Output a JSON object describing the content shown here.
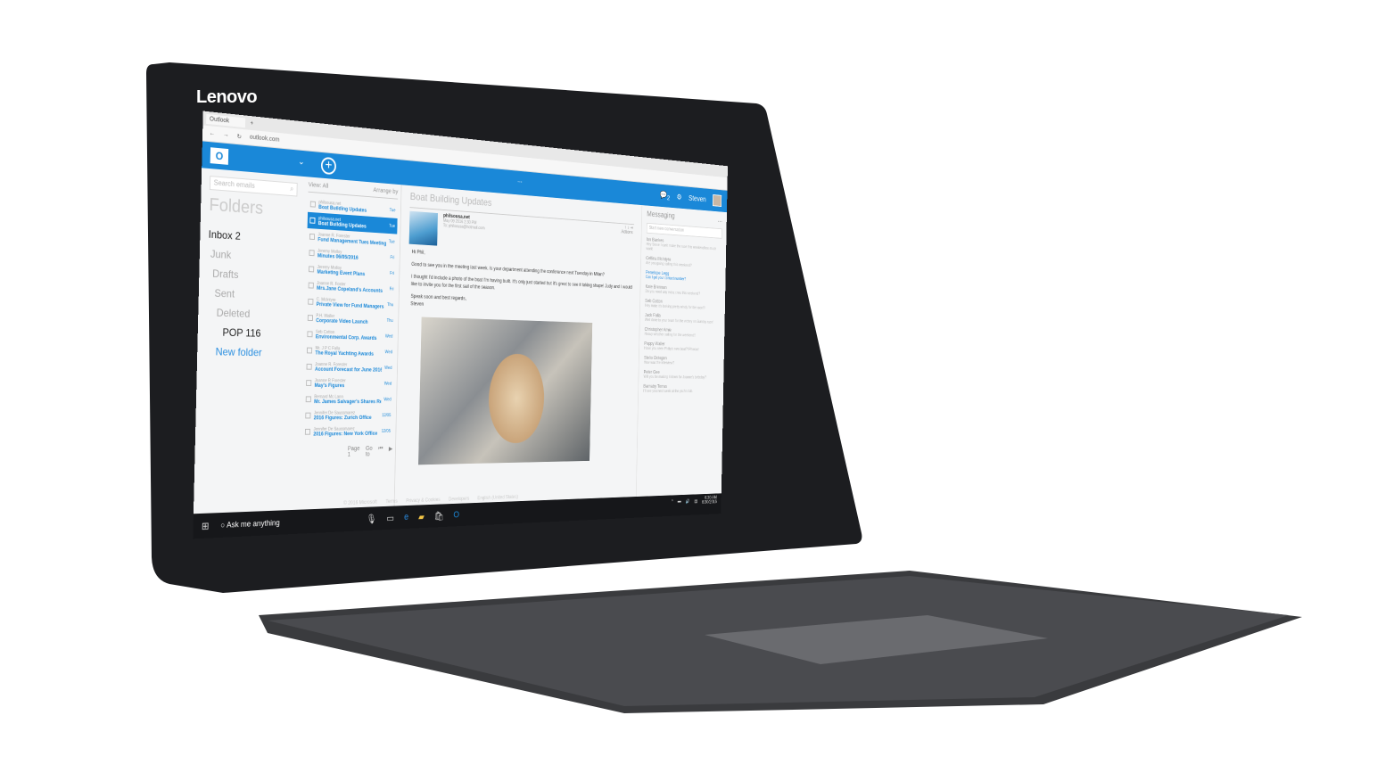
{
  "device": {
    "brand": "Lenovo"
  },
  "browser": {
    "tab": "Outlook",
    "url": "outlook.com"
  },
  "outlook": {
    "logo": "O",
    "user": "Steven",
    "chat_count": "2",
    "more": "..."
  },
  "folders": {
    "search_placeholder": "Search emails",
    "title": "Folders",
    "items": [
      {
        "label": "Inbox",
        "count": "2"
      },
      {
        "label": "Junk"
      },
      {
        "label": "Drafts"
      },
      {
        "label": "Sent"
      },
      {
        "label": "Deleted"
      },
      {
        "label": "POP",
        "count": "116"
      },
      {
        "label": "New folder"
      }
    ]
  },
  "list": {
    "view": "View: All",
    "arrange": "Arrange by",
    "rows": [
      {
        "sender": "philsousa.net",
        "subject": "Boat Building Updates",
        "date": "Tue"
      },
      {
        "sender": "philsousa.net",
        "subject": "Boat Building Updates",
        "date": "Tue",
        "selected": true
      },
      {
        "sender": "Joanne R. Forester",
        "subject": "Fund Management Tues Meeting",
        "date": "Tue"
      },
      {
        "sender": "Jeremy Molloy",
        "subject": "Minutes 06/05/2016",
        "date": "Fri"
      },
      {
        "sender": "Jeremy Molloy",
        "subject": "Marketing Event Plans",
        "date": "Fri"
      },
      {
        "sender": "Joanne R. Foster",
        "subject": "Mrs.Jane Copeland's Accounts",
        "date": "Fri"
      },
      {
        "sender": "C. McIntyre",
        "subject": "Private View for Fund Managers",
        "date": "Thu"
      },
      {
        "sender": "P.H. Waller",
        "subject": "Corporate Video Launch",
        "date": "Thu"
      },
      {
        "sender": "Seb Cotton",
        "subject": "Environmental Corp. Awards",
        "date": "Wed"
      },
      {
        "sender": "Mr. J P C Falla",
        "subject": "The Royal Yachting Awards",
        "date": "Wed"
      },
      {
        "sender": "Joanne R. Forester",
        "subject": "Account Forecast for June 2016",
        "date": "Wed"
      },
      {
        "sender": "Joanne R Forester",
        "subject": "May's Figures",
        "date": "Wed"
      },
      {
        "sender": "Bernard Mc Lann",
        "subject": "Mr. James Salvager's Shares Review",
        "date": "Wed"
      },
      {
        "sender": "Jennifer De Saussmarez",
        "subject": "2016 Figures: Zurich Office",
        "date": "12/05"
      },
      {
        "sender": "Jennifer De Saussmarez",
        "subject": "2016 Figures: New York Office",
        "date": "12/05"
      }
    ],
    "page": "Page 1",
    "goto": "Go to"
  },
  "reading": {
    "title": "Boat Building Updates",
    "from": "philsousa.net",
    "date": "May 09 2016 2:30 PM",
    "to": "To: philsousa@hotmail.com",
    "actions": "Actions",
    "body": [
      "Hi Phil,",
      "Good to see you in the meeting last week. Is your department attending the conference next Tuesday in Milan?",
      "I thought I'd include a photo of the boat I'm having built. It's only just started but it's great to see it taking shape! Judy and I would like to invite you for the first sail of the season.",
      "Speak soon and best regards,",
      "Steven"
    ]
  },
  "messaging": {
    "title": "Messaging",
    "more": "...",
    "placeholder": "Start new conversation",
    "convs": [
      {
        "name": "Ian Bankes",
        "preview": "Hey Steve I can't make the race this weekend too much work!"
      },
      {
        "name": "Cellina McIntyre",
        "preview": "Are you going sailing this weekend?"
      },
      {
        "name": "Penelope Legg",
        "preview": "Can I get your contact number?",
        "active": true
      },
      {
        "name": "Kate Brennan",
        "preview": "Do you need any extra crew this weekend?"
      },
      {
        "name": "Seb Cotton",
        "preview": "Hey mate it's looking pretty windy for the race!!!"
      },
      {
        "name": "Jack Falla",
        "preview": "Well done to your team for the victory on Sunday race!"
      },
      {
        "name": "Christopher Amie",
        "preview": "Heavy weather sailing for the weekend!!"
      },
      {
        "name": "Poppy Waller",
        "preview": "Have you seen Philip's new boat?! Phwoar!"
      },
      {
        "name": "Stelio Octogan",
        "preview": "How was the interview?"
      },
      {
        "name": "Peter Gee",
        "preview": "Will you be making it down for Joanne's birthday?"
      },
      {
        "name": "Barnaby Torras",
        "preview": "I'll see you next week at the yacht club."
      }
    ]
  },
  "footer": [
    "© 2016 Microsoft",
    "Terms",
    "Privacy & Cookies",
    "Developers",
    "English (United States)"
  ],
  "taskbar": {
    "search": "Ask me anything",
    "time": "6:30 AM",
    "date": "6/30/2016"
  },
  "colors": {
    "accent": "#1a88d8",
    "bezel": "#1c1d20"
  }
}
